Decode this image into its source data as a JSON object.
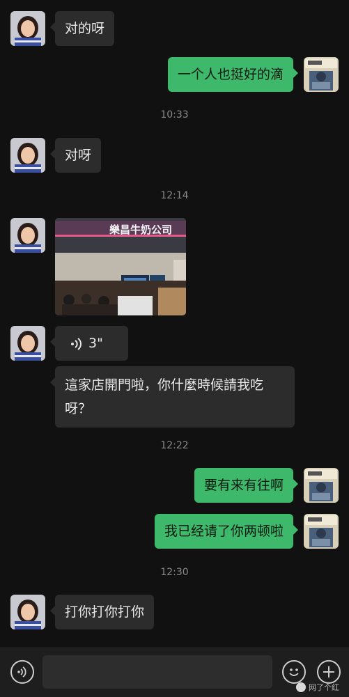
{
  "messages": {
    "m1": "对的呀",
    "m2": "一个人也挺好的滴",
    "m3": "对呀",
    "voice_duration": "3\"",
    "m5": "這家店開門啦，你什麼時候請我吃呀？",
    "m6": "要有来有往啊",
    "m7": "我已经请了你两顿啦",
    "m8": "打你打你打你"
  },
  "photo": {
    "sign_text": "樂昌牛奶公司"
  },
  "timestamps": [
    "10:33",
    "12:14",
    "12:22",
    "12:30"
  ],
  "bottom_bar": {
    "watermark": "网了个红"
  },
  "icons": [
    "voice-icon",
    "emoji-icon",
    "plus-icon"
  ],
  "colors": {
    "background": "#111111",
    "incoming_bubble": "#2c2c2c",
    "outgoing_bubble": "#3eb86a",
    "timestamp": "#8a8a8a"
  }
}
